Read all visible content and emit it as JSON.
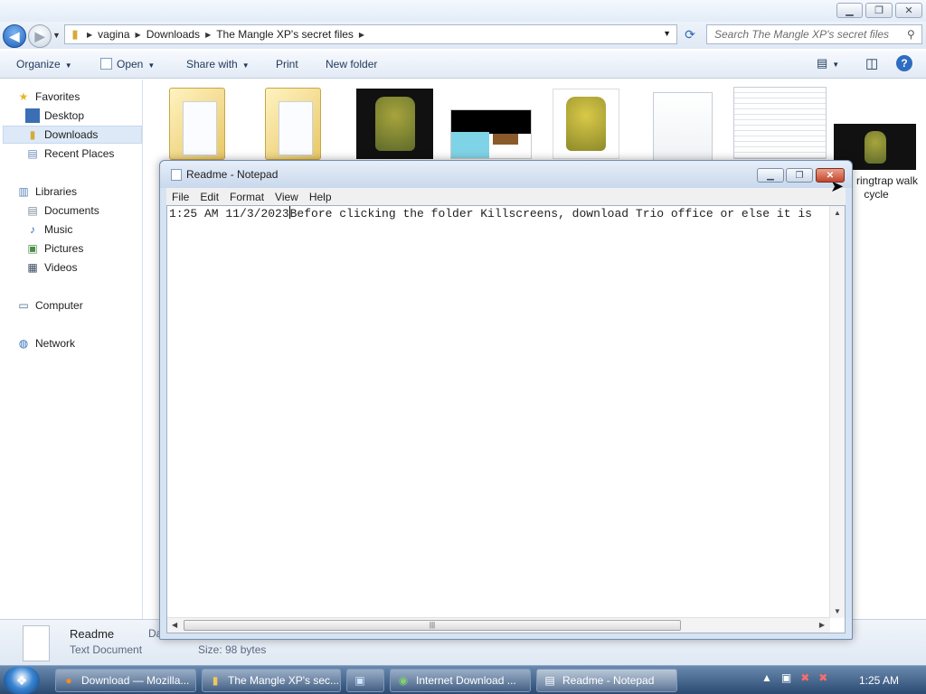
{
  "explorer": {
    "breadcrumbs": [
      "vagina",
      "Downloads",
      "The Mangle XP's secret files"
    ],
    "search_placeholder": "Search The Mangle XP's secret files",
    "commands": {
      "organize": "Organize",
      "open": "Open",
      "share_with": "Share with",
      "print": "Print",
      "new_folder": "New folder"
    },
    "nav": {
      "favorites": "Favorites",
      "desktop": "Desktop",
      "downloads": "Downloads",
      "recent_places": "Recent Places",
      "libraries": "Libraries",
      "documents": "Documents",
      "music": "Music",
      "pictures": "Pictures",
      "videos": "Videos",
      "computer": "Computer",
      "network": "Network"
    },
    "visible_file_label_line1": "ringtrap walk",
    "visible_file_label_line2": "cycle",
    "details": {
      "name": "Readme",
      "type": "Text Document",
      "truncated_label": "Da",
      "size": "Size: 98 bytes"
    }
  },
  "notepad": {
    "title": "Readme - Notepad",
    "menu": [
      "File",
      "Edit",
      "Format",
      "View",
      "Help"
    ],
    "text_before_caret": "1:25 AM 11/3/2023",
    "text_after_caret": "Before clicking the folder Killscreens, download Trio office or else it is"
  },
  "taskbar": {
    "tasks": [
      {
        "label": "Download — Mozilla...",
        "icon": "firefox-icon"
      },
      {
        "label": "The Mangle XP's sec...",
        "icon": "folder-icon"
      },
      {
        "label": "",
        "icon": "network-icon"
      },
      {
        "label": "Internet Download ...",
        "icon": "idm-icon"
      },
      {
        "label": "Readme - Notepad",
        "icon": "notepad-icon"
      }
    ],
    "clock": "1:25 AM"
  }
}
